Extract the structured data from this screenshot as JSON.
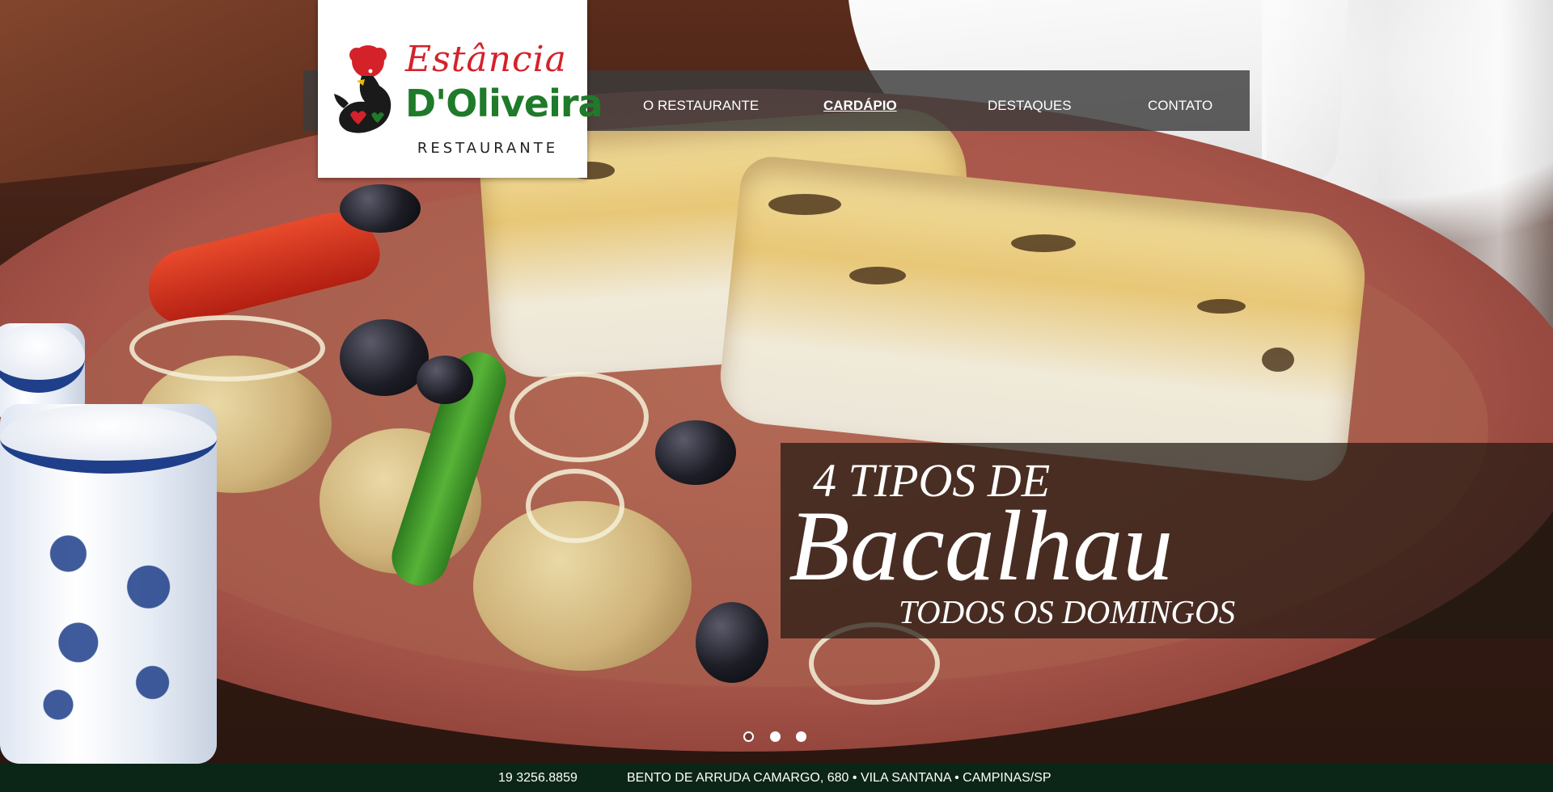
{
  "logo": {
    "line1": "Estância",
    "line2": "D'Oliveira",
    "line3": "RESTAURANTE",
    "colors": {
      "red": "#d4222a",
      "green": "#1f7a2a"
    }
  },
  "nav": {
    "items": [
      {
        "label": "O RESTAURANTE",
        "active": false
      },
      {
        "label": "CARDÁPIO",
        "active": true
      },
      {
        "label": "DESTAQUES",
        "active": false
      },
      {
        "label": "CONTATO",
        "active": false
      }
    ]
  },
  "promo": {
    "line1": "4 TIPOS DE",
    "line2": "Bacalhau",
    "line3": "TODOS OS DOMINGOS"
  },
  "slider": {
    "total": 3,
    "active_index": 0
  },
  "footer": {
    "phone": "19  3256.8859",
    "address": "BENTO DE ARRUDA CAMARGO, 680 • VILA SANTANA • CAMPINAS/SP",
    "background": "#0b2616"
  }
}
